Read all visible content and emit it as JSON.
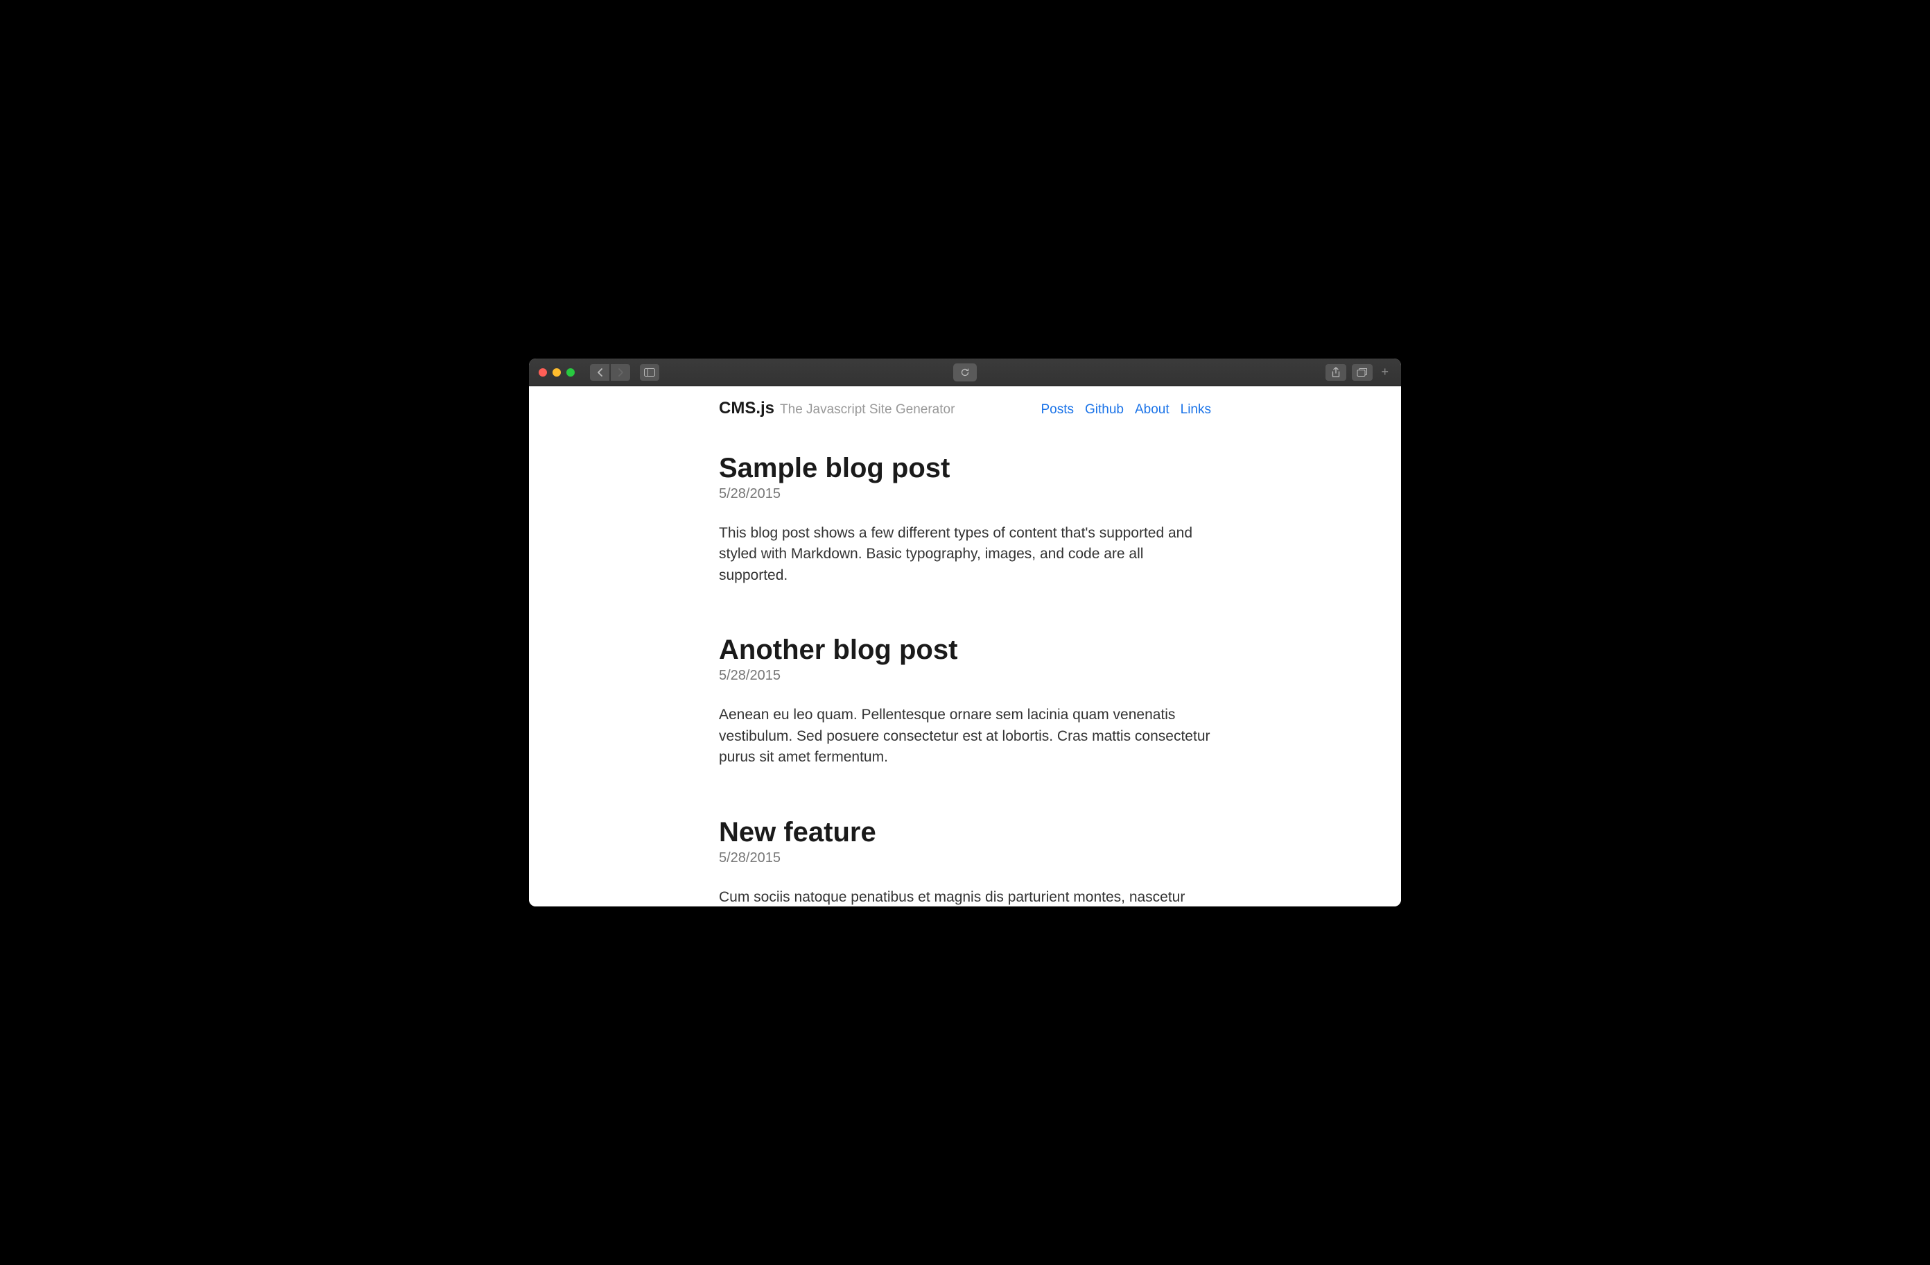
{
  "brand": {
    "title": "CMS.js",
    "subtitle": "The Javascript Site Generator"
  },
  "nav": {
    "items": [
      {
        "label": "Posts"
      },
      {
        "label": "Github"
      },
      {
        "label": "About"
      },
      {
        "label": "Links"
      }
    ]
  },
  "posts": [
    {
      "title": "Sample blog post",
      "date": "5/28/2015",
      "body": "This blog post shows a few different types of content that's supported and styled with Markdown. Basic typography, images, and code are all supported."
    },
    {
      "title": "Another blog post",
      "date": "5/28/2015",
      "body": "Aenean eu leo quam. Pellentesque ornare sem lacinia quam venenatis vestibulum. Sed posuere consectetur est at lobortis. Cras mattis consectetur purus sit amet fermentum."
    },
    {
      "title": "New feature",
      "date": "5/28/2015",
      "body": "Cum sociis natoque penatibus et magnis dis parturient montes, nascetur ridiculus mus. Aenean lacinia bibendum nulla sed consectetur."
    }
  ]
}
